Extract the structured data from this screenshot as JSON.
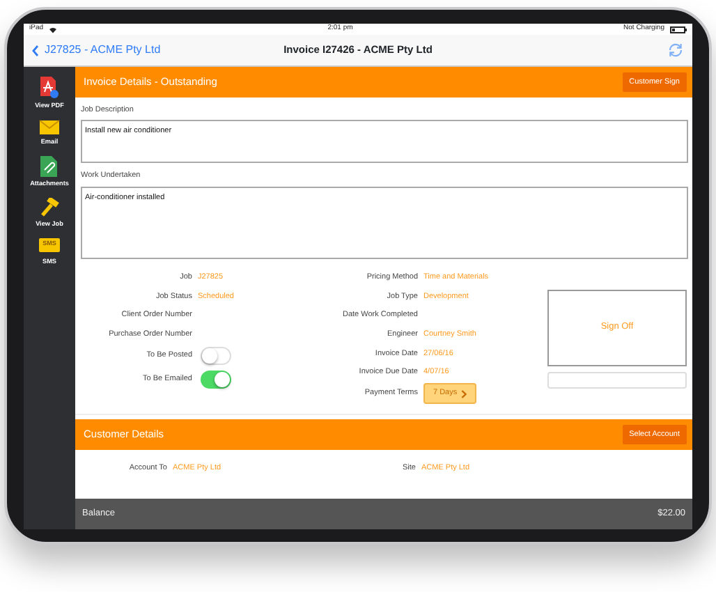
{
  "status_bar": {
    "carrier": "iPad",
    "time": "2:01 pm",
    "battery_status": "Not Charging"
  },
  "nav": {
    "back": "J27825 - ACME Pty Ltd",
    "title": "Invoice I27426 - ACME Pty Ltd"
  },
  "sidebar": {
    "items": [
      {
        "label": "View PDF",
        "kind": "pdf"
      },
      {
        "label": "Email",
        "kind": "email"
      },
      {
        "label": "Attachments",
        "kind": "attachment"
      },
      {
        "label": "View Job",
        "kind": "hammer"
      },
      {
        "label": "SMS",
        "kind": "sms",
        "icon_text": "SMS"
      }
    ]
  },
  "invoice_section": {
    "title": "Invoice Details - Outstanding",
    "button": "Customer Sign"
  },
  "job_description": {
    "label": "Job Description",
    "value": "Install new air conditioner"
  },
  "work_undertaken": {
    "label": "Work Undertaken",
    "value": "Air-conditioner installed"
  },
  "left_fields": [
    {
      "kind": "text",
      "label": "Job",
      "value": "J27825"
    },
    {
      "kind": "text",
      "label": "Job Status",
      "value": "Scheduled"
    },
    {
      "kind": "text",
      "label": "Client Order Number"
    },
    {
      "kind": "text",
      "label": "Purchase Order Number"
    },
    {
      "kind": "toggle",
      "label": "To Be Posted",
      "on": false
    },
    {
      "kind": "toggle",
      "label": "To Be Emailed",
      "on": true
    }
  ],
  "right_fields": [
    {
      "kind": "text",
      "label": "Pricing Method",
      "value": "Time and Materials"
    },
    {
      "kind": "text",
      "label": "Job Type",
      "value": "Development"
    },
    {
      "kind": "text",
      "label": "Date Work Completed"
    },
    {
      "kind": "text",
      "label": "Engineer",
      "value": "Courtney Smith"
    },
    {
      "kind": "text",
      "label": "Invoice Date",
      "value": "27/06/16"
    },
    {
      "kind": "text",
      "label": "Invoice Due Date",
      "value": "4/07/16"
    },
    {
      "kind": "button",
      "label": "Payment Terms",
      "value": "7 Days"
    }
  ],
  "sign_off": "Sign Off",
  "customer_section": {
    "title": "Customer Details",
    "button": "Select Account",
    "fields": [
      {
        "label": "Account To",
        "value": "ACME Pty Ltd"
      },
      {
        "label": "Site",
        "value": "ACME Pty Ltd"
      }
    ]
  },
  "balance": {
    "label": "Balance",
    "value": "$22.00"
  }
}
